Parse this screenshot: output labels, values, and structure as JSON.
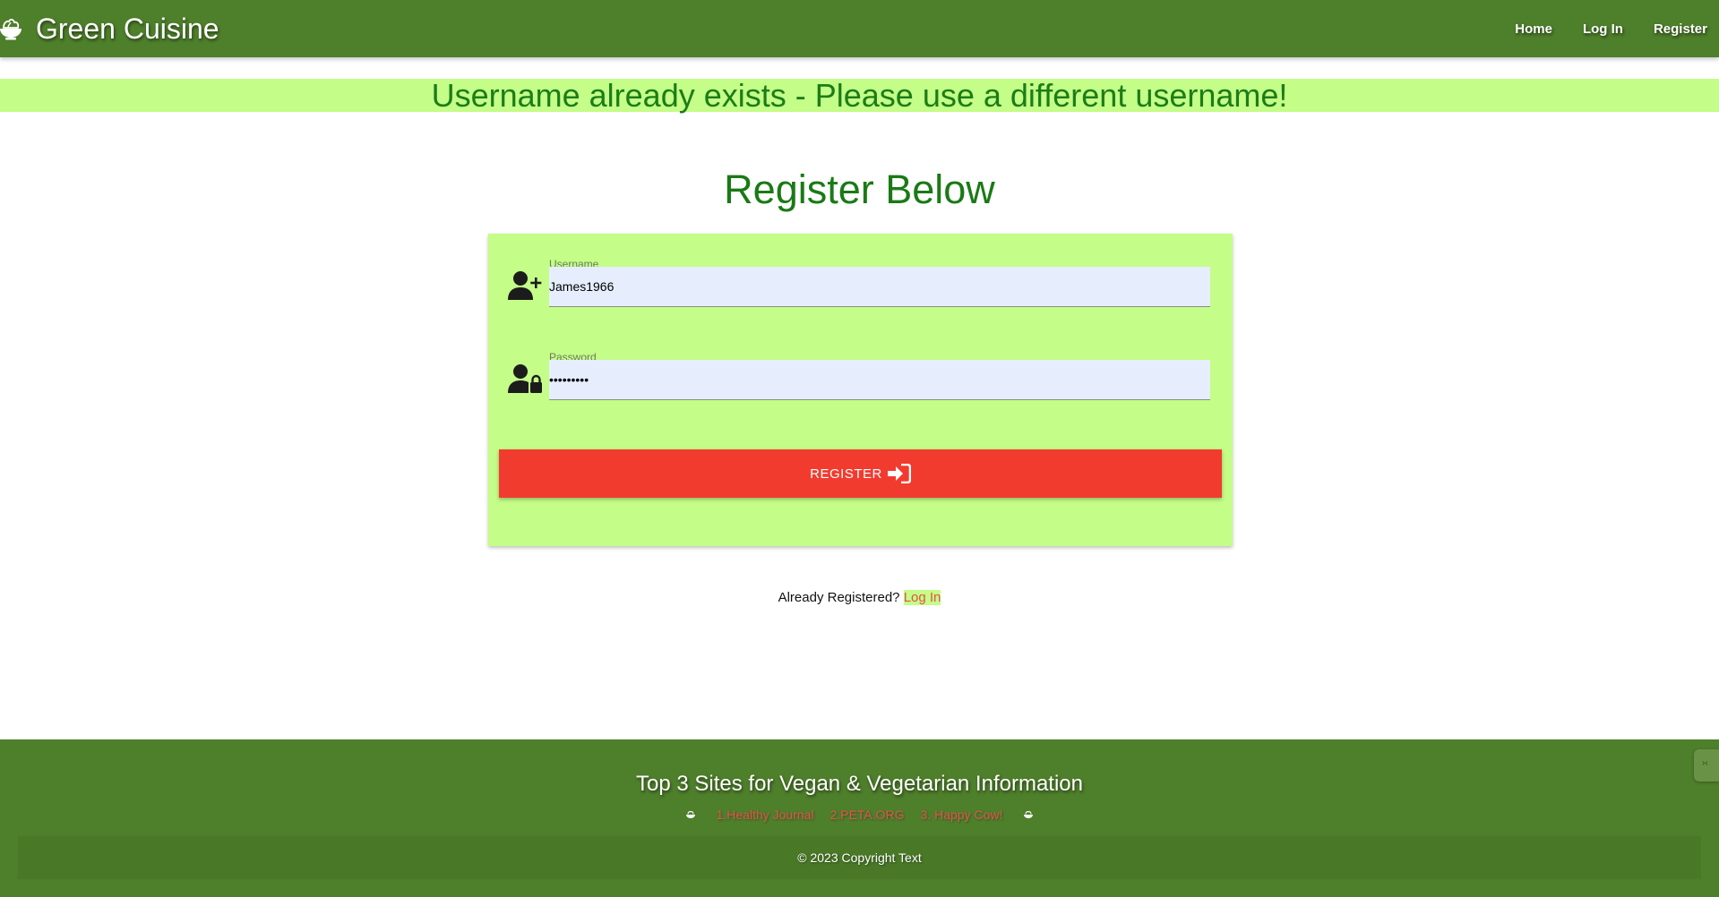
{
  "navbar": {
    "brand_icon": "salad-bowl-icon",
    "brand": "Green Cuisine",
    "links": [
      "Home",
      "Log In",
      "Register"
    ]
  },
  "alert": {
    "message": "Username already exists - Please use a different username!"
  },
  "page": {
    "title": "Register Below"
  },
  "form": {
    "username": {
      "icon": "user-plus-icon",
      "label": "Username",
      "value": "James1966"
    },
    "password": {
      "icon": "user-lock-icon",
      "label": "Password",
      "value": "•••••••••"
    },
    "submit": {
      "label": "REGISTER",
      "icon": "sign-in-icon"
    }
  },
  "login_prompt": {
    "text": "Already Registered?",
    "link": "Log In"
  },
  "footer": {
    "title": "Top 3 Sites for Vegan & Vegetarian Information",
    "decor_icon": "salad-bowl-icon",
    "links": [
      "1.Healthy Journal",
      "2.PETA.ORG",
      "3. Happy Cow!"
    ],
    "copyright": "© 2023 Copyright Text"
  },
  "colors": {
    "primary_green": "#4e7f2b",
    "light_green": "#c4fd87",
    "accent_red": "#f23b2f",
    "link_red": "#e4534b",
    "title_green": "#1a7a16"
  }
}
